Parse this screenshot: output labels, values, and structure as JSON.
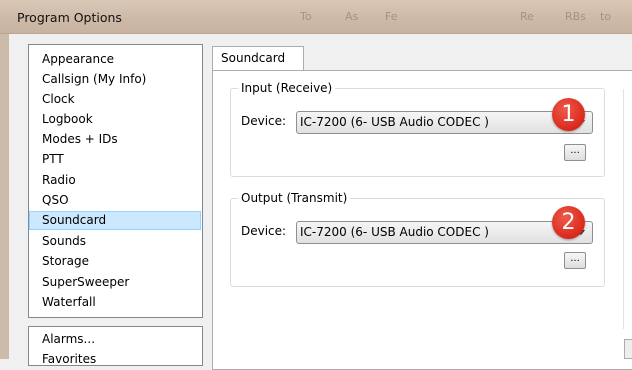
{
  "window": {
    "title": "Program Options",
    "background_text": [
      "To",
      "As",
      "Fe",
      "Re",
      "RBs",
      "to"
    ]
  },
  "sidebar": {
    "items": [
      {
        "label": "Appearance",
        "selected": false
      },
      {
        "label": "Callsign (My Info)",
        "selected": false
      },
      {
        "label": "Clock",
        "selected": false
      },
      {
        "label": "Logbook",
        "selected": false
      },
      {
        "label": "Modes + IDs",
        "selected": false
      },
      {
        "label": "PTT",
        "selected": false
      },
      {
        "label": "Radio",
        "selected": false
      },
      {
        "label": "QSO",
        "selected": false
      },
      {
        "label": "Soundcard",
        "selected": true
      },
      {
        "label": "Sounds",
        "selected": false
      },
      {
        "label": "Storage",
        "selected": false
      },
      {
        "label": "SuperSweeper",
        "selected": false
      },
      {
        "label": "Waterfall",
        "selected": false
      }
    ],
    "extra_items": [
      "Alarms...",
      "Favorites"
    ]
  },
  "tab": {
    "label": "Soundcard"
  },
  "input_group": {
    "legend": "Input (Receive)",
    "device_label": "Device:",
    "device_value": "IC-7200 (6- USB Audio CODEC )",
    "browse_label": "...",
    "badge": "1"
  },
  "output_group": {
    "legend": "Output (Transmit)",
    "device_label": "Device:",
    "device_value": "IC-7200 (6- USB Audio CODEC )",
    "browse_label": "...",
    "badge": "2"
  },
  "colors": {
    "selection_bg": "#cce8ff",
    "badge_red": "#d9281c",
    "titlebar": "#cdb9a6"
  }
}
